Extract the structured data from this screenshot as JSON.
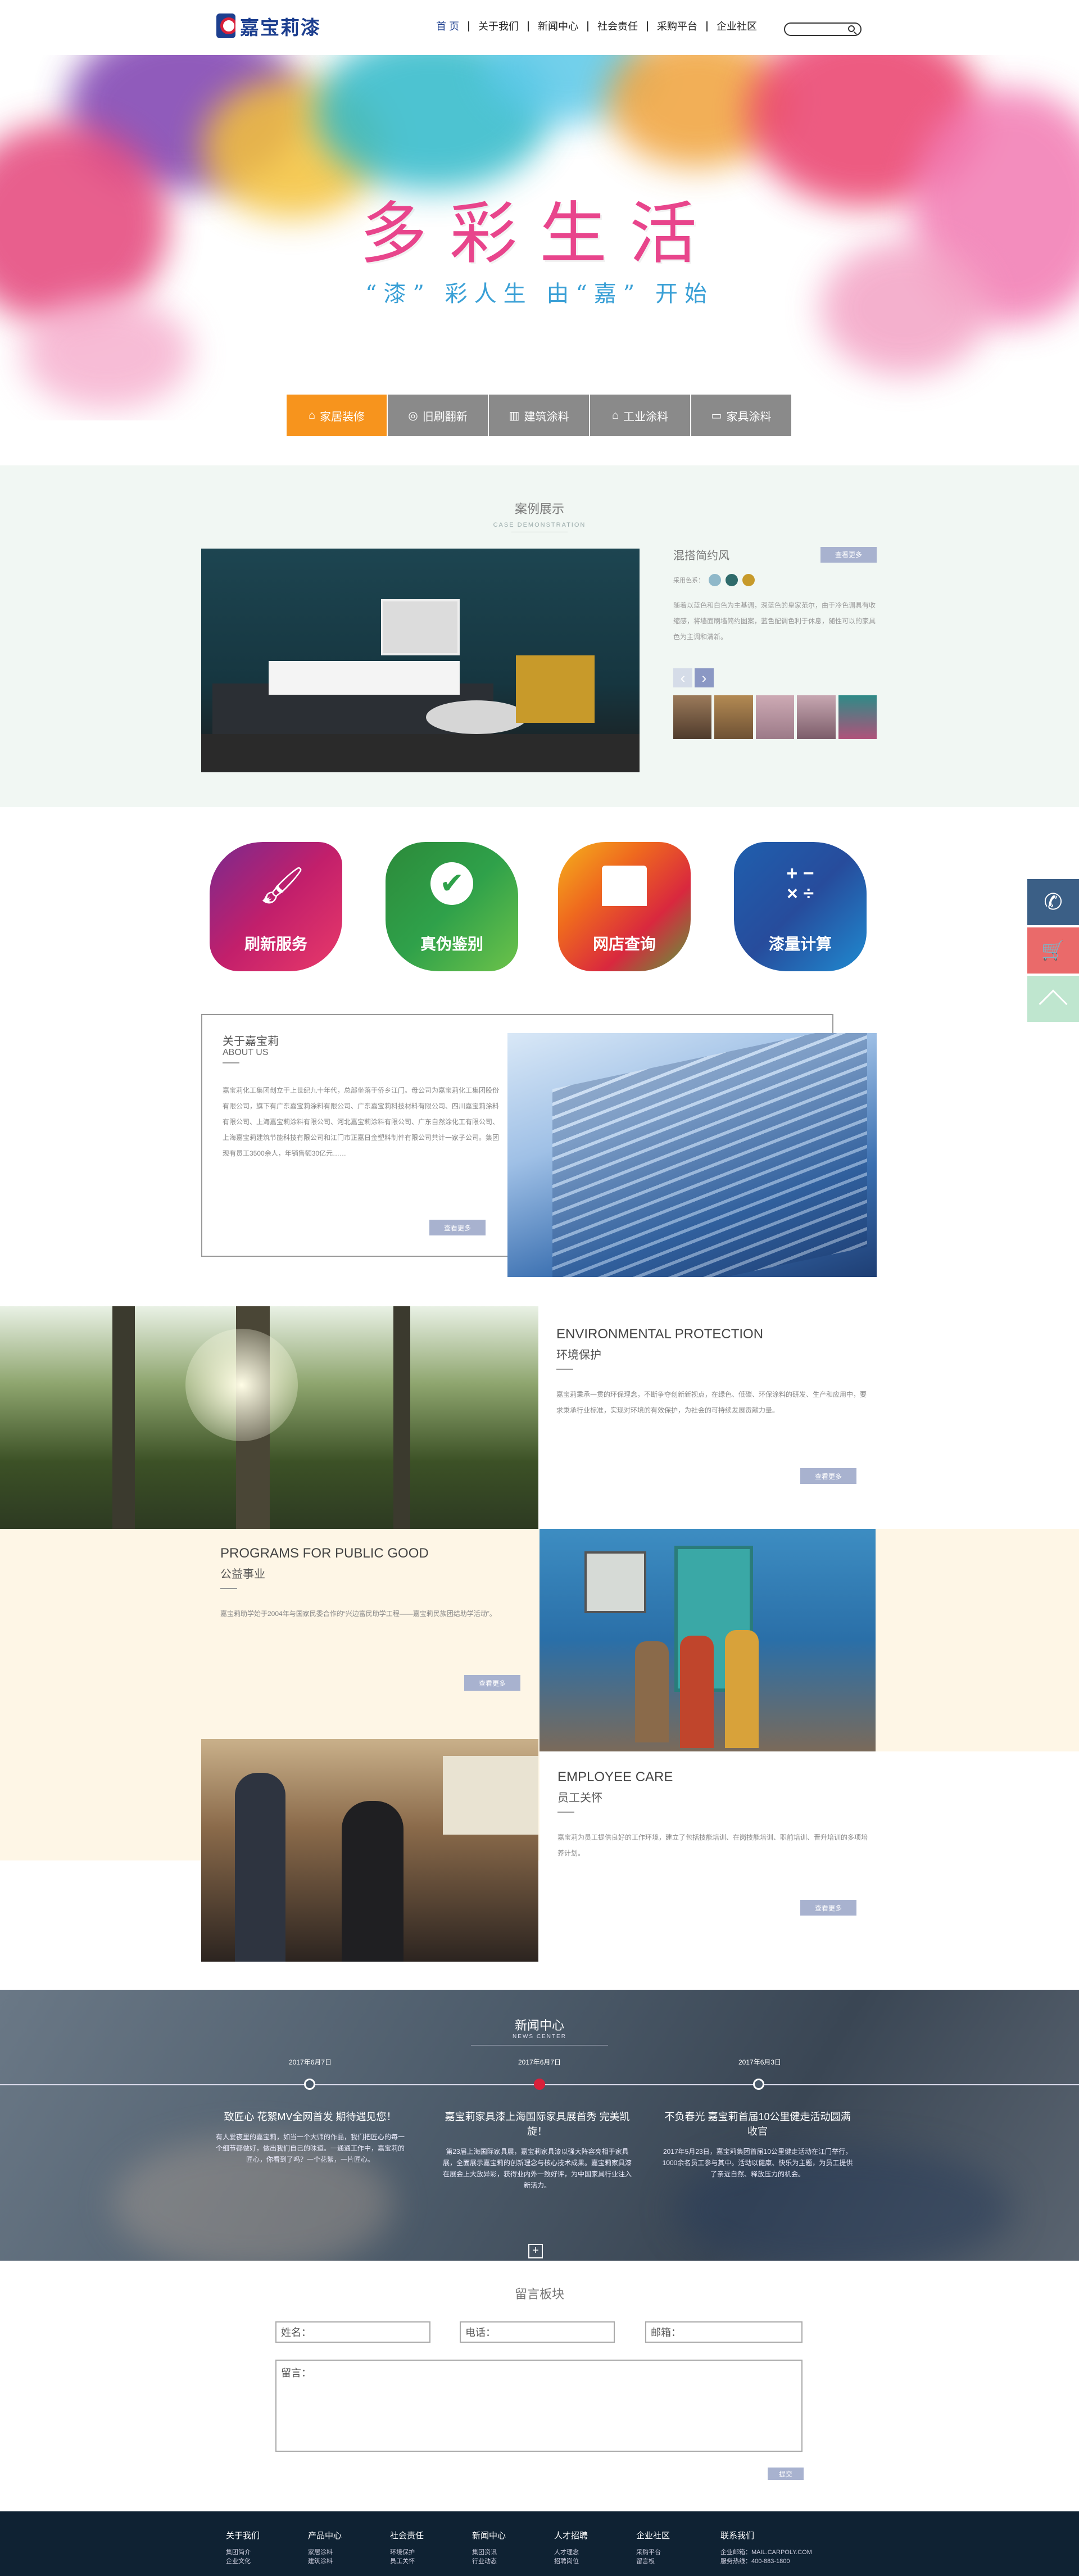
{
  "brand": {
    "name": "嘉宝莉漆"
  },
  "nav": {
    "items": [
      "首 页",
      "关于我们",
      "新闻中心",
      "社会责任",
      "采购平台",
      "企业社区"
    ]
  },
  "banner": {
    "slogan": "多彩生活",
    "subslogan": "“漆” 彩人生  由“嘉” 开始"
  },
  "tabs": [
    {
      "label": "家居装修",
      "icon": "house-icon"
    },
    {
      "label": "旧刷翻新",
      "icon": "refresh-icon"
    },
    {
      "label": "建筑涂料",
      "icon": "building-icon"
    },
    {
      "label": "工业涂料",
      "icon": "factory-icon"
    },
    {
      "label": "家具涂料",
      "icon": "sofa-icon"
    }
  ],
  "case": {
    "title": "案例展示",
    "subtitle": "CASE DEMONSTRATION",
    "name": "混搭简约风",
    "more": "查看更多",
    "colors_label": "采用色系：",
    "colors": [
      "#8fb8c9",
      "#2f6b6b",
      "#c79a2a"
    ],
    "desc": "随着以蓝色和白色为主基调，深蓝色的皇家范尔，由于冷色调具有收缩感，将墙面刷墙简约图案，蓝色配调色利于休息，随性可以的家具色为主调和清新。",
    "arrow_left": "‹",
    "arrow_right": "›"
  },
  "services": [
    "刷新服务",
    "真伪鉴别",
    "网店查询",
    "漆量计算"
  ],
  "about": {
    "title": "关于嘉宝莉",
    "subtitle": "ABOUT US",
    "text": "嘉宝莉化工集团创立于上世纪九十年代，总部坐落于侨乡江门。母公司为嘉宝莉化工集团股份有限公司，旗下有广东嘉宝莉涂料有限公司、广东嘉宝莉科技材料有限公司、四川嘉宝莉涂料有限公司、上海嘉宝莉涂料有限公司、河北嘉宝莉涂料有限公司、广东自然涂化工有限公司、上海嘉宝莉建筑节能科技有限公司和江门市正嘉日金塑料制件有限公司共计一家子公司。集团现有员工3500余人，年销售额30亿元……",
    "more": "查看更多"
  },
  "env": {
    "title_en": "ENVIRONMENTAL PROTECTION",
    "title_cn": "环境保护",
    "text": "嘉宝莉秉承一贯的环保理念，不断争夺创新新视点，在绿色、低碳、环保涂料的研发、生产和应用中，要求秉承行业标准，实现对环境的有效保护，为社会的可持续发展贡献力量。",
    "more": "查看更多"
  },
  "public": {
    "title_en": "PROGRAMS FOR PUBLIC GOOD",
    "title_cn": "公益事业",
    "text": "嘉宝莉助学始于2004年与国家民委合作的“兴边富民助学工程——嘉宝莉民族团结助学活动”。",
    "more": "查看更多"
  },
  "employee": {
    "title_en": "EMPLOYEE CARE",
    "title_cn": "员工关怀",
    "text": "嘉宝莉为员工提供良好的工作环境，建立了包括技能培训、在岗技能培训、职前培训、晋升培训的多项培养计划。",
    "more": "查看更多"
  },
  "news": {
    "title": "新闻中心",
    "subtitle": "NEWS CENTER",
    "items": [
      {
        "date": "2017年6月7日",
        "title": "致匠心 花絮MV全网首发 期待遇见您！",
        "text": "有人爱夜里的嘉宝莉，如当一个大师的作品，我们把匠心的每一个细节都做好，做出我们自己的味道。一通通工作中，嘉宝莉的匠心，你看到了吗？一个花絮，一片匠心。"
      },
      {
        "date": "2017年6月7日",
        "title": "嘉宝莉家具漆上海国际家具展首秀 完美凯旋！",
        "text": "第23届上海国际家具展，嘉宝莉家具漆以强大阵容亮相于家具展，全面展示嘉宝莉的创新理念与核心技术成果。嘉宝莉家具漆在展会上大放异彩，获得业内外一致好评，为中国家具行业注入新活力。"
      },
      {
        "date": "2017年6月3日",
        "title": "不负春光 嘉宝莉首届10公里健走活动圆满收官",
        "text": "2017年5月23日，嘉宝莉集团首届10公里健走活动在江门举行，1000余名员工参与其中。活动以健康、快乐为主题，为员工提供了亲近自然、释放压力的机会。"
      }
    ],
    "more_icon": "plus-icon"
  },
  "message": {
    "title": "留言板块",
    "name_label": "姓名：",
    "phone_label": "电话：",
    "email_label": "邮箱：",
    "content_label": "留言：",
    "submit": "提交"
  },
  "footer": {
    "cols": [
      {
        "title": "关于我们",
        "links": [
          "集团简介",
          "企业文化"
        ]
      },
      {
        "title": "产品中心",
        "links": [
          "家居涂料",
          "建筑涂料"
        ]
      },
      {
        "title": "社会责任",
        "links": [
          "环境保护",
          "员工关怀"
        ]
      },
      {
        "title": "新闻中心",
        "links": [
          "集团资讯",
          "行业动态"
        ]
      },
      {
        "title": "人才招聘",
        "links": [
          "人才理念",
          "招聘岗位"
        ]
      },
      {
        "title": "企业社区",
        "links": [
          "采购平台",
          "留言板"
        ]
      }
    ],
    "contact_title": "联系我们",
    "contact_lines": [
      "企业邮箱：MAIL.CARPOLY.COM",
      "服务热线：400-883-1800"
    ]
  },
  "side": {
    "phone_icon": "phone-icon",
    "cart_icon": "cart-icon",
    "top_icon": "back-to-top-icon"
  },
  "colors": {
    "brand_blue": "#1d3f8f",
    "accent_orange": "#f7941d",
    "case_bg": "#f1f7f3",
    "footer_bg": "#0f2233",
    "button": "#a8b2cf"
  }
}
